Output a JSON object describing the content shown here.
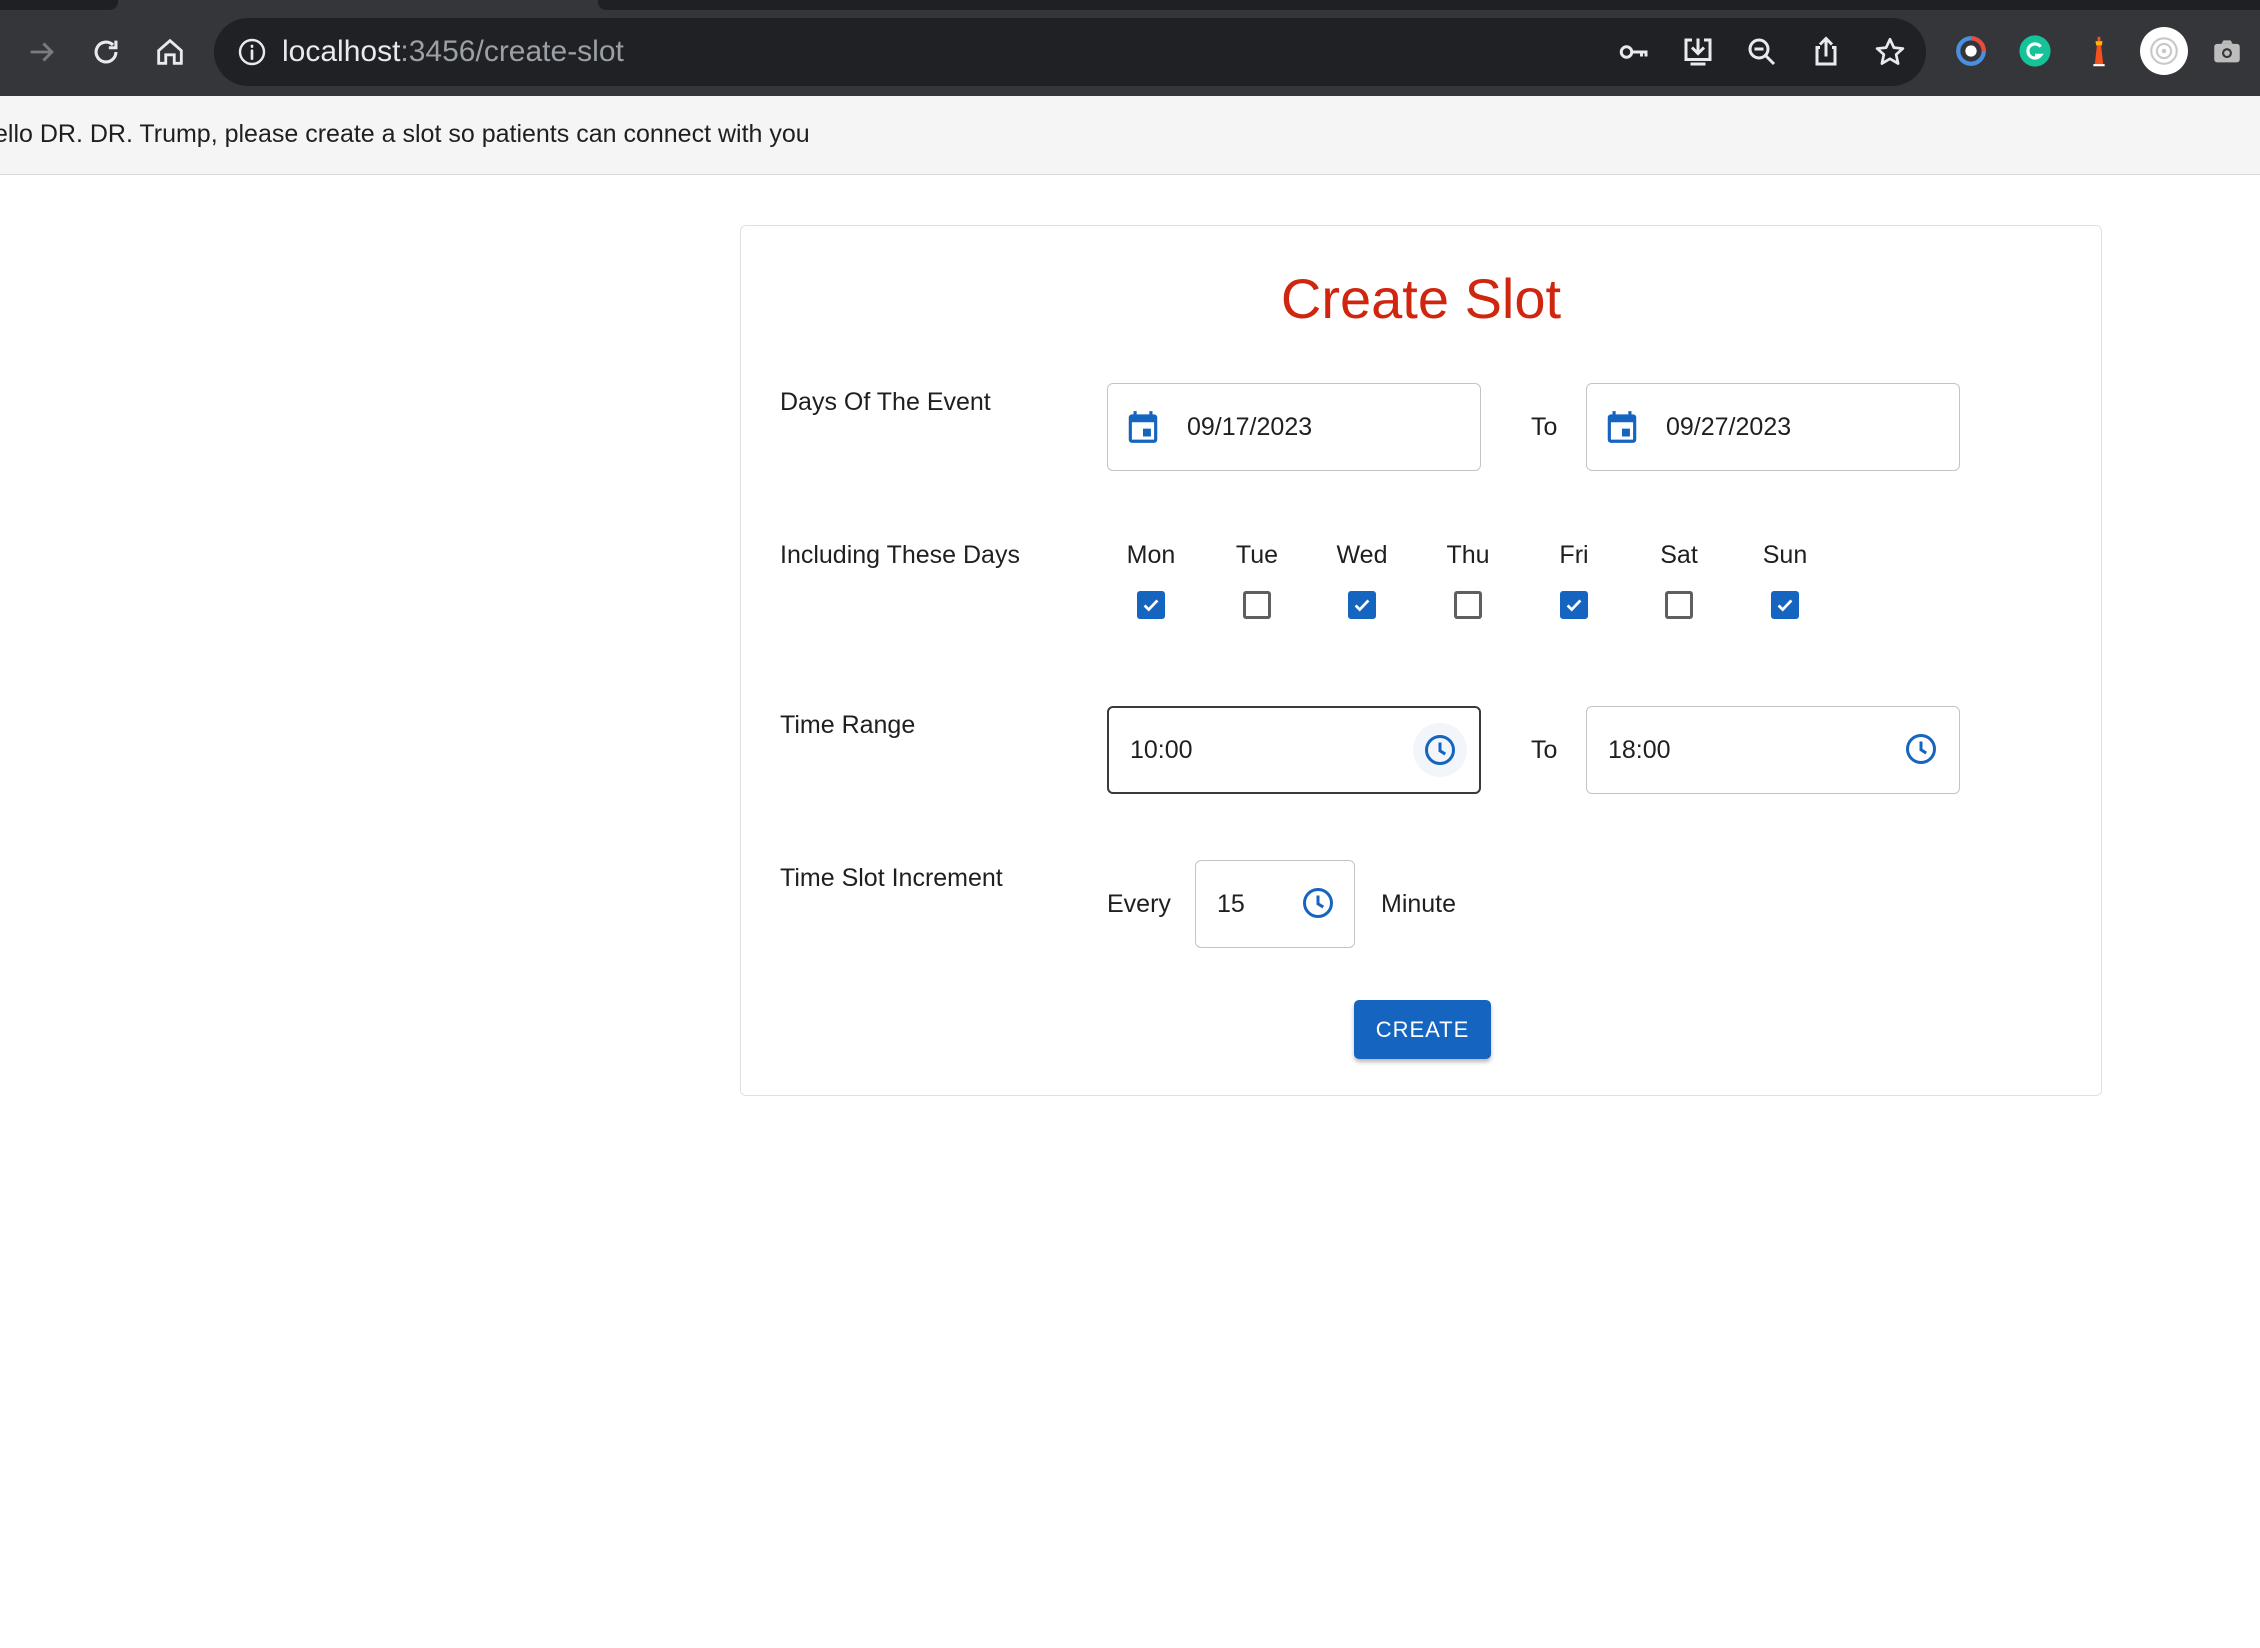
{
  "browser": {
    "url_host": "localhost",
    "url_path": ":3456/create-slot"
  },
  "greeting": "ello DR. DR. Trump, please create a slot so patients can connect with you",
  "form": {
    "title": "Create Slot",
    "days_of_event": {
      "label": "Days Of The Event",
      "from": "09/17/2023",
      "to_label": "To",
      "to": "09/27/2023"
    },
    "including_days": {
      "label": "Including These Days",
      "days": [
        {
          "name": "Mon",
          "checked": true
        },
        {
          "name": "Tue",
          "checked": false
        },
        {
          "name": "Wed",
          "checked": true
        },
        {
          "name": "Thu",
          "checked": false
        },
        {
          "name": "Fri",
          "checked": true
        },
        {
          "name": "Sat",
          "checked": false
        },
        {
          "name": "Sun",
          "checked": true
        }
      ]
    },
    "time_range": {
      "label": "Time Range",
      "from": "10:00",
      "to_label": "To",
      "to": "18:00"
    },
    "increment": {
      "label": "Time Slot Increment",
      "prefix": "Every",
      "value": "15",
      "suffix": "Minute"
    },
    "create_label": "CREATE"
  },
  "colors": {
    "title": "#d0260f",
    "primary": "#1565c0"
  }
}
